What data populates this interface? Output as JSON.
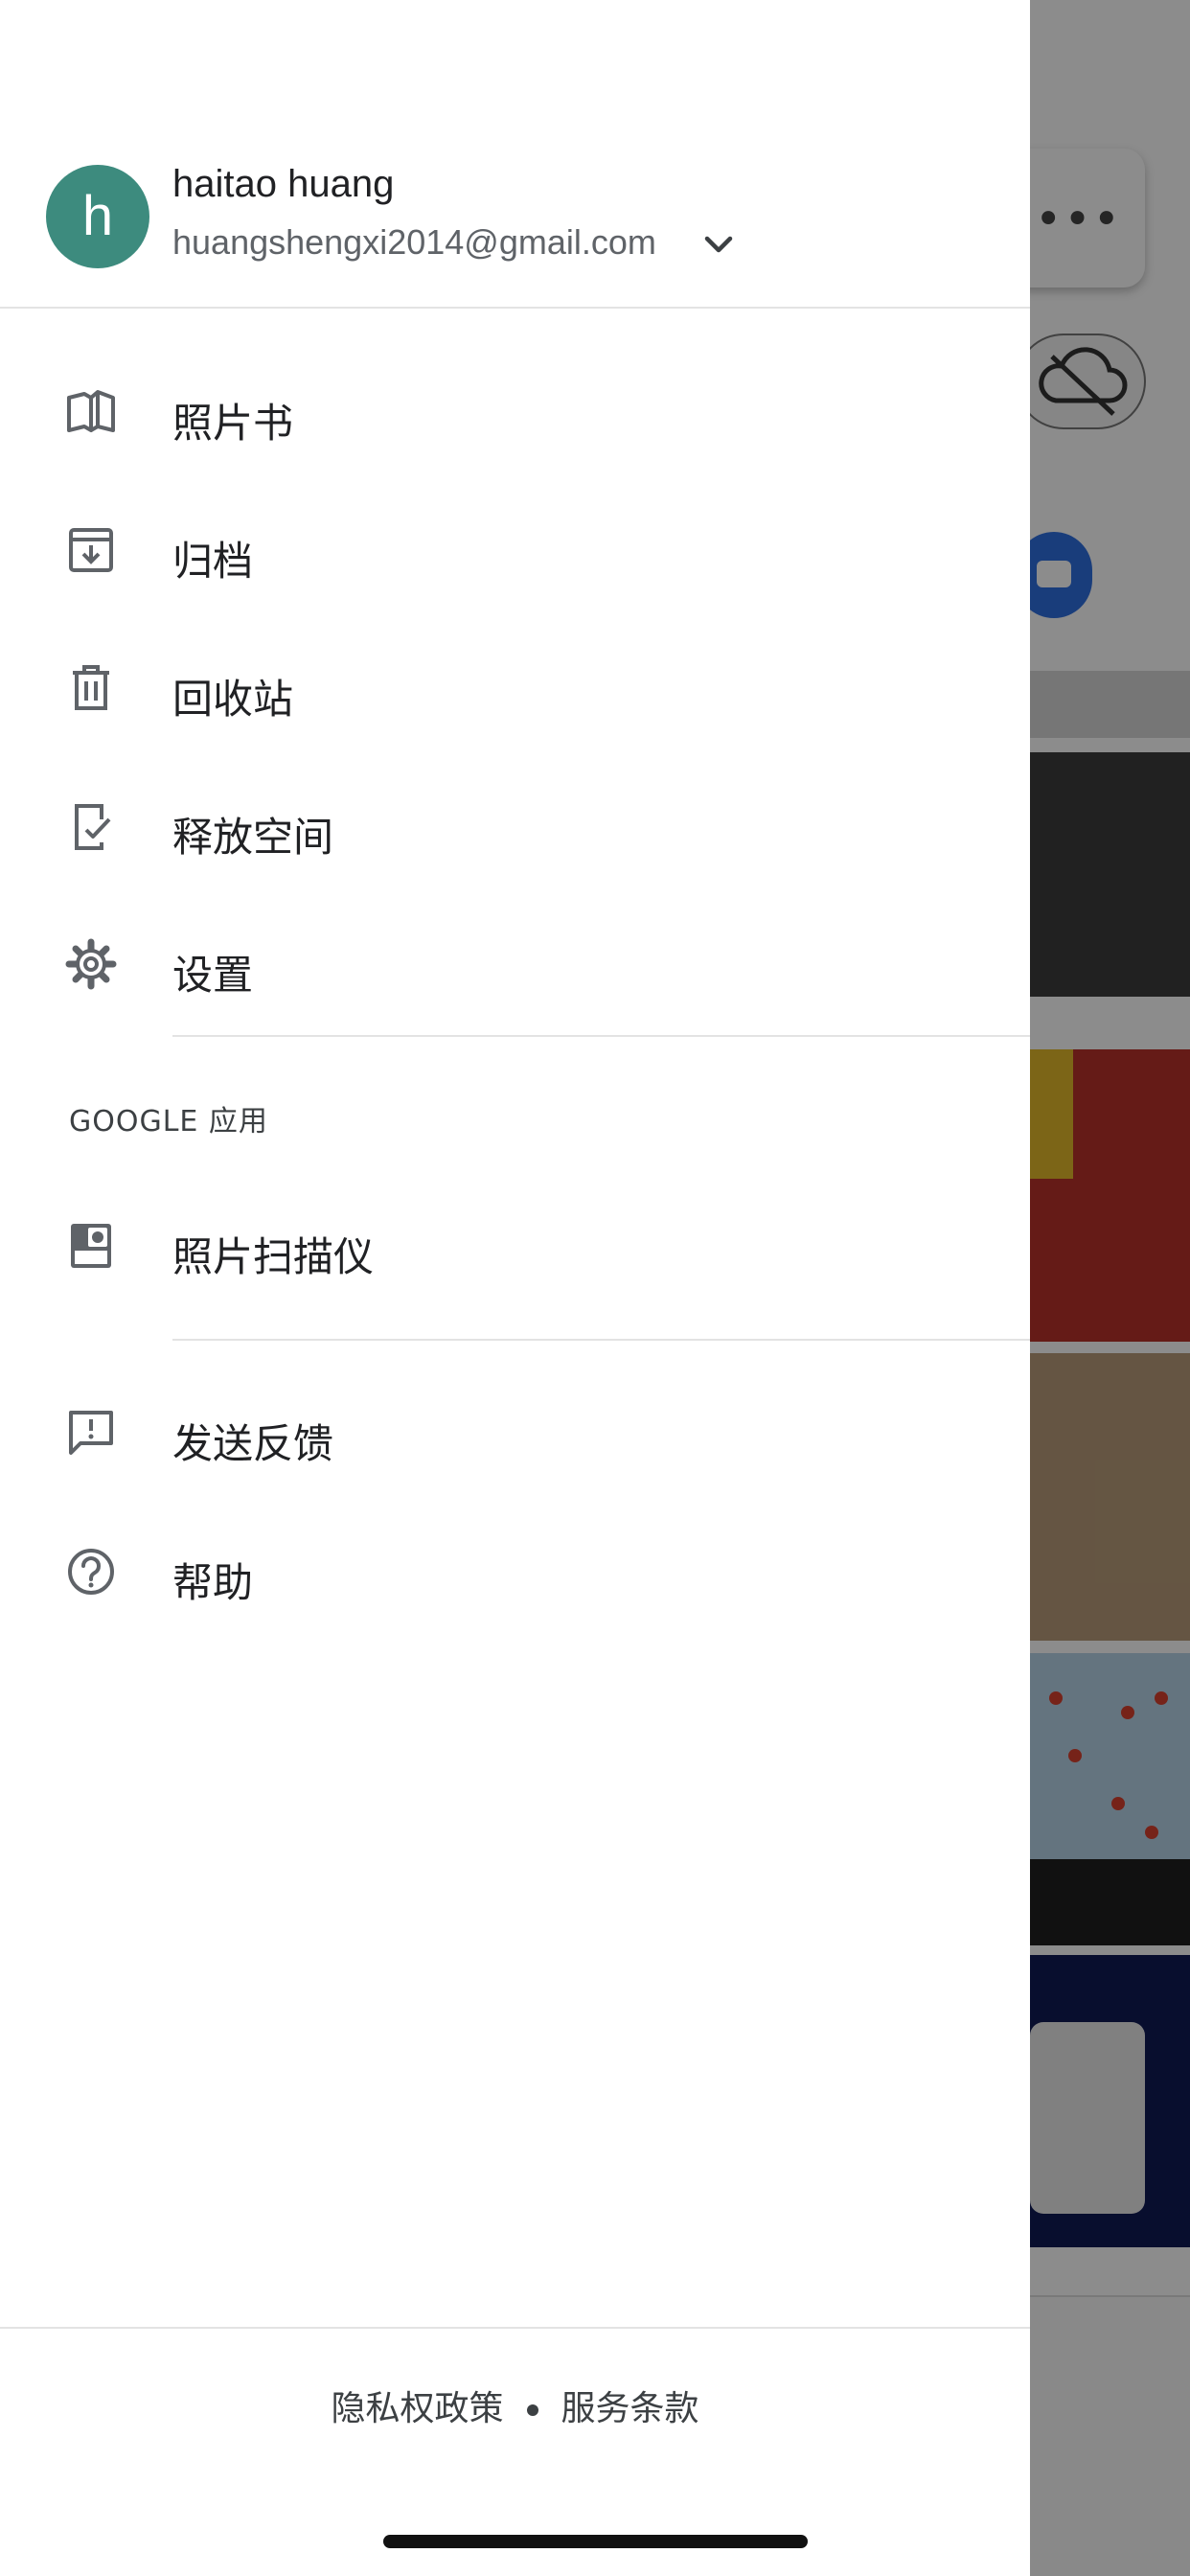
{
  "account": {
    "avatar_initial": "h",
    "name": "haitao huang",
    "email": "huangshengxi2014@gmail.com"
  },
  "menu": {
    "items": [
      {
        "label": "照片书",
        "icon": "photo-book-icon"
      },
      {
        "label": "归档",
        "icon": "archive-icon"
      },
      {
        "label": "回收站",
        "icon": "trash-icon"
      },
      {
        "label": "释放空间",
        "icon": "free-up-space-icon"
      },
      {
        "label": "设置",
        "icon": "gear-icon"
      }
    ],
    "google_apps_title": "GOOGLE 应用",
    "google_apps": [
      {
        "label": "照片扫描仪",
        "icon": "photoscan-icon"
      }
    ],
    "support": [
      {
        "label": "发送反馈",
        "icon": "feedback-icon"
      },
      {
        "label": "帮助",
        "icon": "help-icon"
      }
    ]
  },
  "footer": {
    "privacy": "隐私权政策",
    "terms": "服务条款"
  },
  "colors": {
    "avatar": "#3d8b7e",
    "text_primary": "#202124",
    "text_secondary": "#5f6368",
    "divider": "#e3e3e3",
    "scrim": "rgba(0,0,0,0.45)"
  }
}
